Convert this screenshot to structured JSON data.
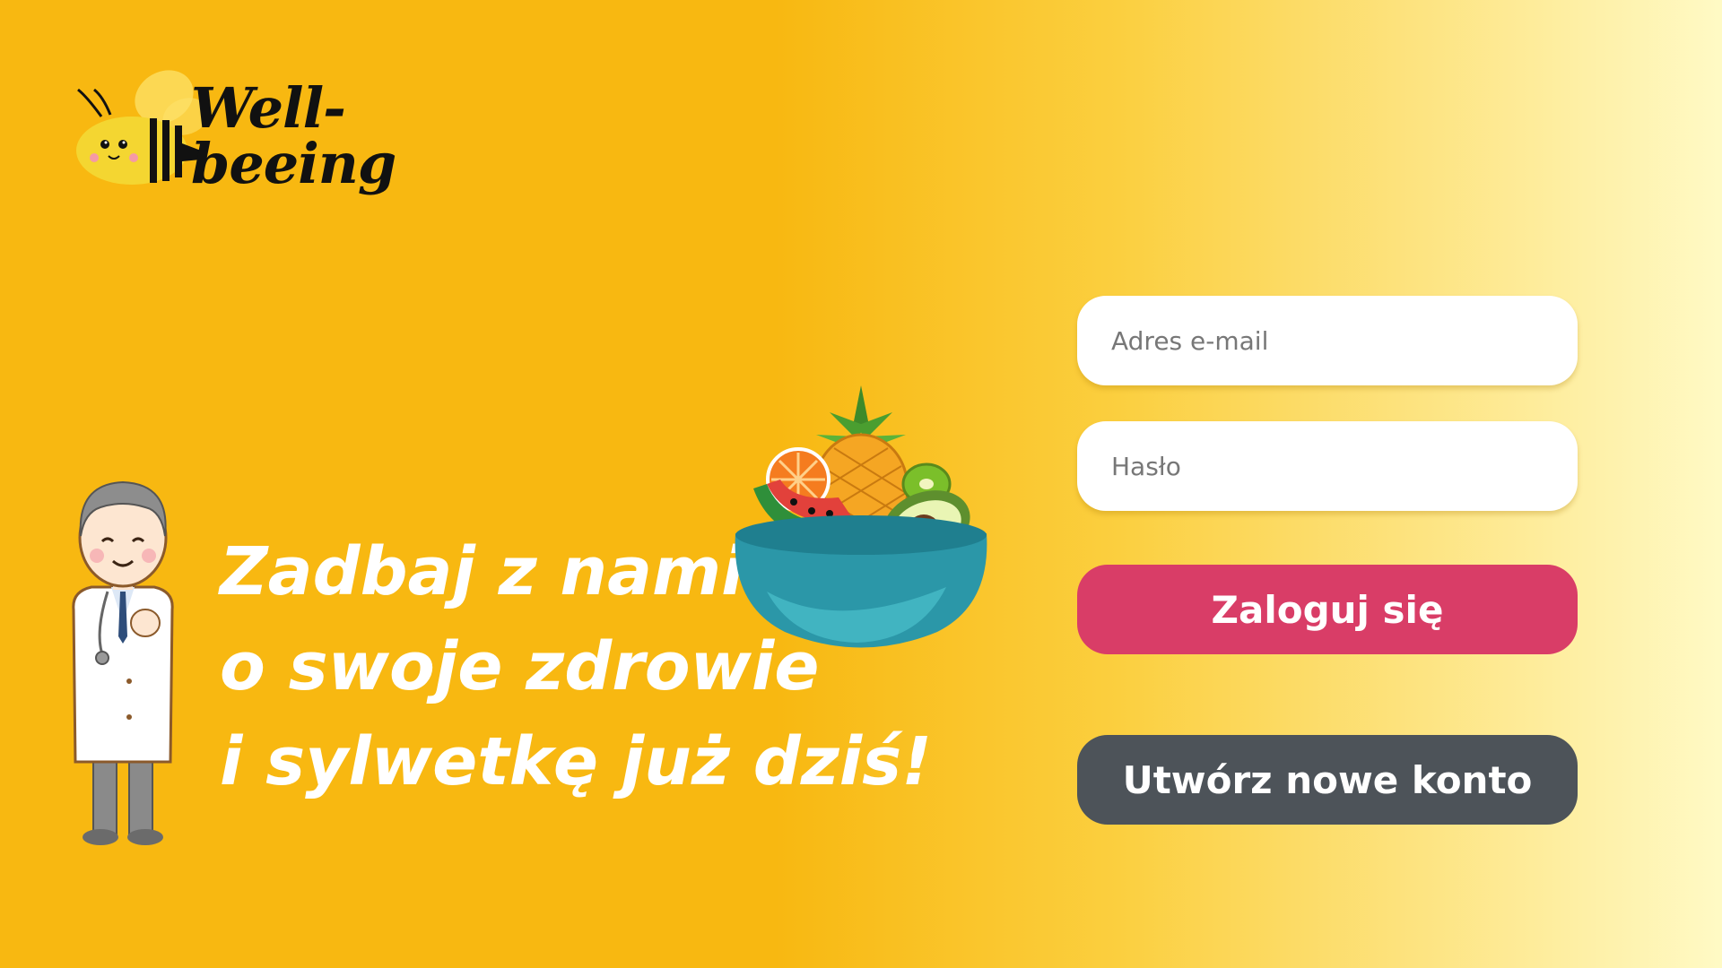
{
  "app": {
    "logo_text": "Well-beeing"
  },
  "hero": {
    "headline_line1": "Zadbaj z nami",
    "headline_line2": "o swoje zdrowie",
    "headline_line3": "i sylwetkę już dziś!"
  },
  "login_form": {
    "email_placeholder": "Adres e-mail",
    "email_value": "",
    "password_placeholder": "Hasło",
    "password_value": "",
    "login_label": "Zaloguj się",
    "register_label": "Utwórz nowe konto"
  },
  "colors": {
    "background_left": "#f8b811",
    "background_right": "#fffac5",
    "login_button": "#d93d67",
    "register_button": "#4d5359",
    "headline_text": "#ffffff"
  },
  "icons": {
    "logo": "bee-logo-icon",
    "doctor": "doctor-illustration",
    "bowl": "fruit-bowl-illustration"
  }
}
